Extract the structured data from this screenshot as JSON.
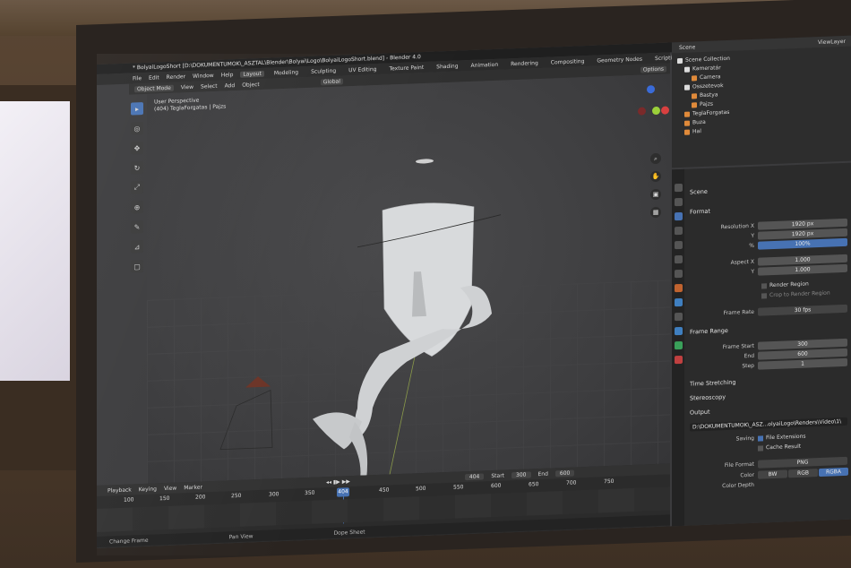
{
  "title_bar": "* BolyaiLogoShort [D:\\DOKUMENTUMOK\\_ASZTAL\\Blender\\Bolyai\\Logo\\BolyaiLogoShort.blend] - Blender 4.0",
  "menu": [
    "File",
    "Edit",
    "Render",
    "Window",
    "Help"
  ],
  "workspaces": [
    "Layout",
    "Modeling",
    "Sculpting",
    "UV Editing",
    "Texture Paint",
    "Shading",
    "Animation",
    "Rendering",
    "Compositing",
    "Geometry Nodes",
    "Scripting"
  ],
  "viewport_header": {
    "mode": "Object Mode",
    "menus": [
      "View",
      "Select",
      "Add",
      "Object"
    ],
    "orientation": "Global",
    "options": "Options"
  },
  "viewport_info": {
    "line1": "User Perspective",
    "line2": "(404) TeglaForgatas | Pajzs"
  },
  "gizmo": {
    "z_label": "Z",
    "y_label": "Y",
    "x_label": "X"
  },
  "timeline": {
    "menus": [
      "Playback",
      "Keying",
      "View",
      "Marker"
    ],
    "current_frame": "404",
    "start_label": "Start",
    "start_value": "300",
    "end_label": "End",
    "end_value": "600",
    "ruler": [
      "100",
      "150",
      "200",
      "250",
      "300",
      "350",
      "404",
      "450",
      "500",
      "550",
      "600",
      "650",
      "700",
      "750"
    ],
    "playhead": "404"
  },
  "statusbar": [
    "Change Frame",
    "Pan View",
    "Dope Sheet"
  ],
  "outliner": {
    "header": "Scene",
    "view_layer": "ViewLayer",
    "items": [
      {
        "label": "Scene Collection",
        "indent": 0,
        "color": "#dcdcdc"
      },
      {
        "label": "Kameratár",
        "indent": 1,
        "color": "#dcdcdc"
      },
      {
        "label": "Camera",
        "indent": 2,
        "color": "#e08a3a"
      },
      {
        "label": "Osszetevok",
        "indent": 1,
        "color": "#dcdcdc"
      },
      {
        "label": "Bastya",
        "indent": 2,
        "color": "#e08a3a"
      },
      {
        "label": "Pajzs",
        "indent": 2,
        "color": "#e08a3a"
      },
      {
        "label": "TeglaForgatas",
        "indent": 1,
        "color": "#e08a3a"
      },
      {
        "label": "Buza",
        "indent": 1,
        "color": "#e08a3a"
      },
      {
        "label": "Hal",
        "indent": 1,
        "color": "#e08a3a"
      }
    ]
  },
  "properties": {
    "scene_label": "Scene",
    "format_section": "Format",
    "resolution_x_label": "Resolution X",
    "resolution_x": "1920 px",
    "resolution_y_label": "Y",
    "resolution_y": "1920 px",
    "percent_label": "%",
    "percent": "100%",
    "aspect_x_label": "Aspect X",
    "aspect_x": "1.000",
    "aspect_y_label": "Y",
    "aspect_y": "1.000",
    "render_region": "Render Region",
    "crop_region": "Crop to Render Region",
    "frame_rate_label": "Frame Rate",
    "frame_rate": "30 fps",
    "frame_range_section": "Frame Range",
    "frame_start_label": "Frame Start",
    "frame_start": "300",
    "end_label": "End",
    "end": "600",
    "step_label": "Step",
    "step": "1",
    "time_stretching": "Time Stretching",
    "stereoscopy": "Stereoscopy",
    "output_section": "Output",
    "output_path": "D:\\DOKUMENTUMOK\\_ASZ...olyaiLogo\\Renders\\Video\\1\\",
    "saving_label": "Saving",
    "file_extensions": "File Extensions",
    "cache_result": "Cache Result",
    "file_format_label": "File Format",
    "file_format": "PNG",
    "color_label": "Color",
    "color_options": [
      "BW",
      "RGB",
      "RGBA"
    ],
    "color_depth_label": "Color Depth"
  }
}
